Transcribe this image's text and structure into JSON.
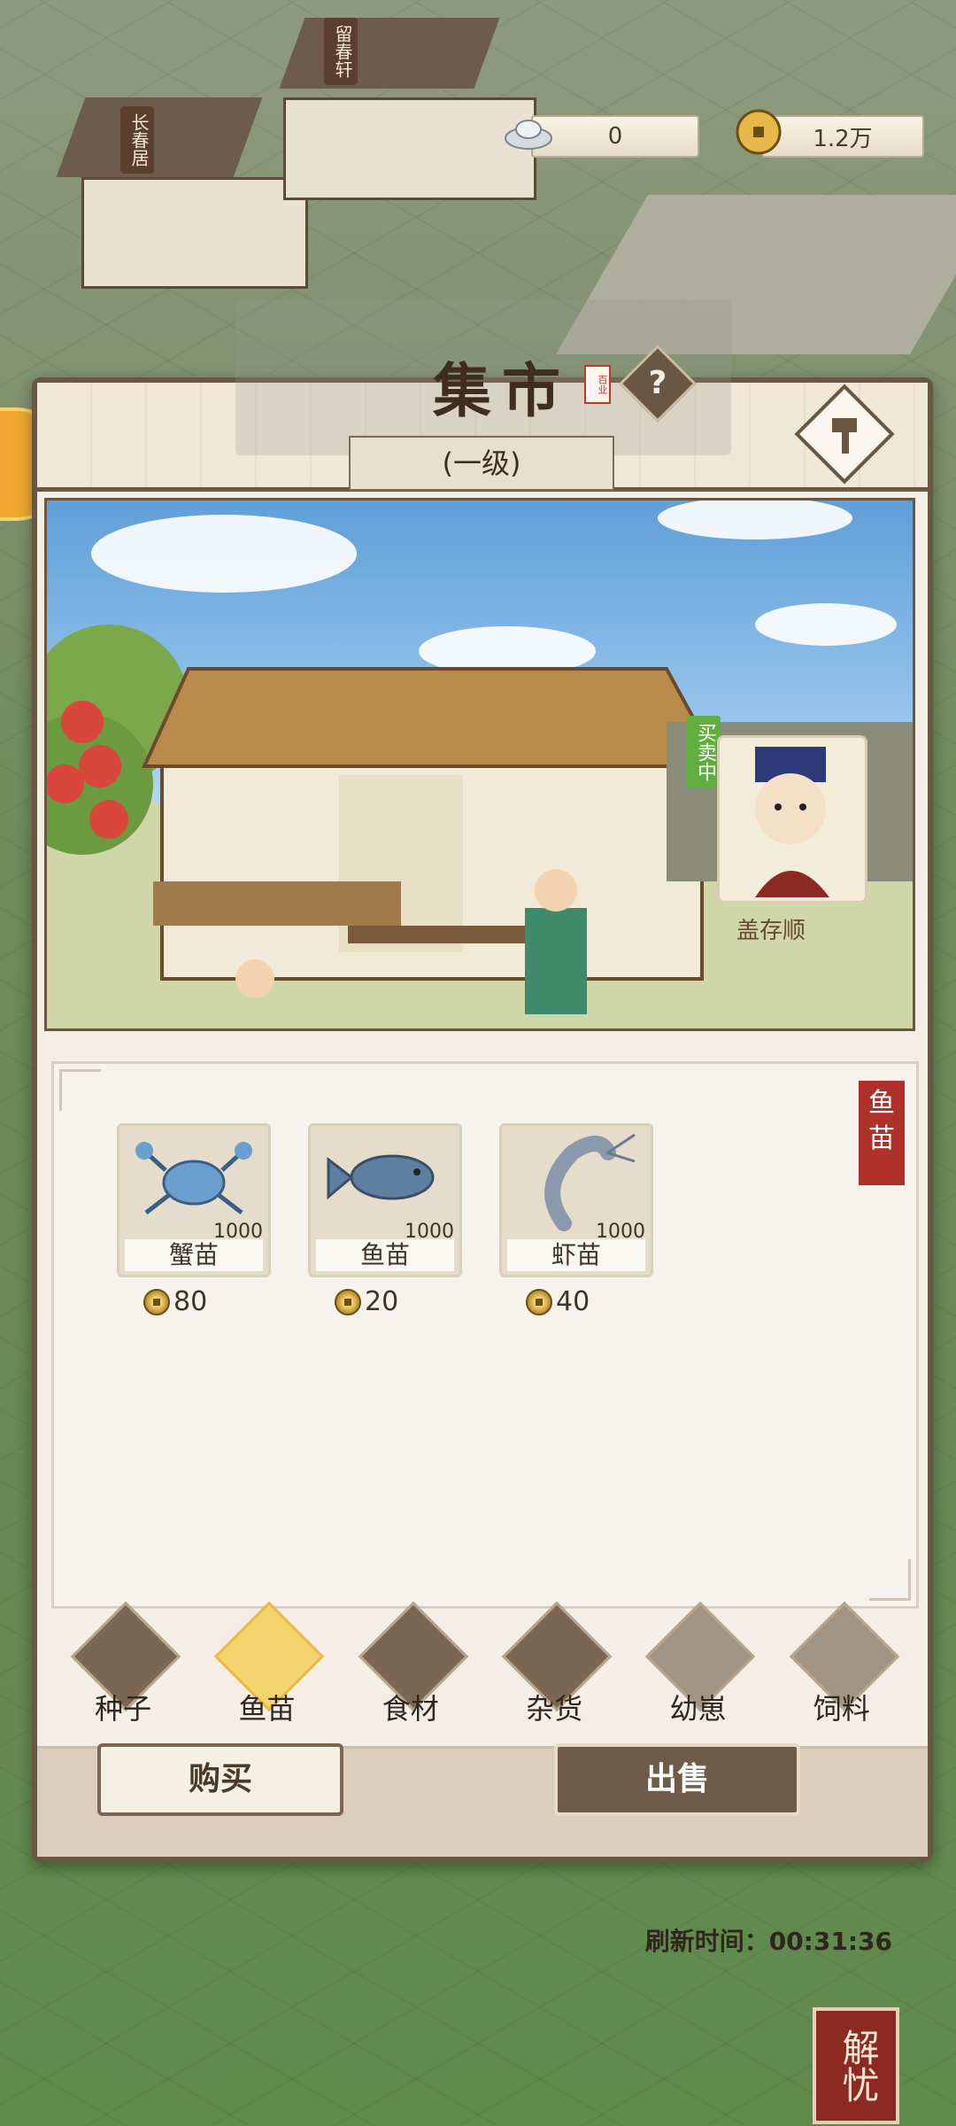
{
  "currency": {
    "silver": "0",
    "copper": "1.2万"
  },
  "map": {
    "sign_1": "长春居",
    "sign_2": "留春轩"
  },
  "market": {
    "title": "集市",
    "level": "(一级)",
    "help": "?",
    "status_tag": "买卖中",
    "merchant_name": "盖存顺"
  },
  "goods": {
    "category_tag": "鱼苗",
    "items": [
      {
        "name": "蟹苗",
        "qty": "1000",
        "price": "80",
        "icon": "crab-icon"
      },
      {
        "name": "鱼苗",
        "qty": "1000",
        "price": "20",
        "icon": "fish-icon"
      },
      {
        "name": "虾苗",
        "qty": "1000",
        "price": "40",
        "icon": "shrimp-icon"
      }
    ],
    "refresh_label": "刷新时间：",
    "refresh_time": "00:31:36"
  },
  "tabs": [
    {
      "label": "种子",
      "state": "normal"
    },
    {
      "label": "鱼苗",
      "state": "active"
    },
    {
      "label": "食材",
      "state": "normal"
    },
    {
      "label": "杂货",
      "state": "normal"
    },
    {
      "label": "幼崽",
      "state": "locked"
    },
    {
      "label": "饲料",
      "state": "locked"
    }
  ],
  "actions": {
    "buy": "购买",
    "sell": "出售"
  },
  "corner_button": "解忧",
  "colors": {
    "panel_border": "#6a5742",
    "active_tab": "#f3d46d",
    "status_green": "#5fae3e",
    "seal_red": "#b0302a"
  }
}
